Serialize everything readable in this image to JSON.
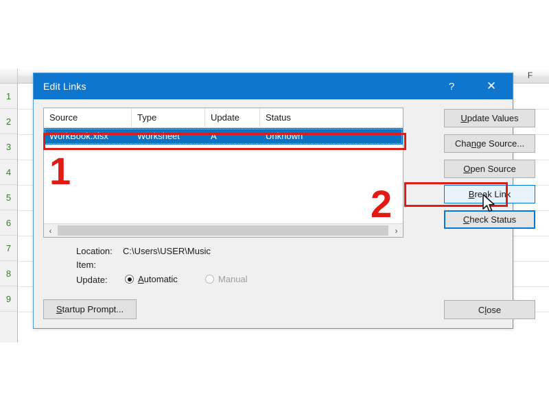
{
  "background": {
    "app": "Microsoft Excel",
    "column_headers": [
      "F"
    ],
    "row_headers": [
      "1",
      "2",
      "3",
      "4",
      "5",
      "6",
      "7",
      "8",
      "9"
    ]
  },
  "dialog": {
    "title": "Edit Links",
    "help_icon": "?",
    "close_icon": "✕",
    "list": {
      "columns": [
        "Source",
        "Type",
        "Update",
        "Status"
      ],
      "rows": [
        {
          "source": "WorkBook.xlsx",
          "type": "Worksheet",
          "update": "A",
          "status": "Unknown",
          "selected": true
        }
      ],
      "scrollbar": {
        "left_arrow": "‹",
        "right_arrow": "›"
      }
    },
    "buttons": {
      "update_values": {
        "pre": "U",
        "post": "pdate Values"
      },
      "change_source": {
        "pre": "Cha",
        "mid": "n",
        "post": "ge Source..."
      },
      "open_source": {
        "pre": "O",
        "post": "pen Source"
      },
      "break_link": {
        "pre": "B",
        "post": "reak Link"
      },
      "check_status": {
        "pre": "C",
        "post": "heck Status"
      },
      "startup_prompt": {
        "pre": "S",
        "post": "tartup Prompt..."
      },
      "close": {
        "pre": "C",
        "mid": "l",
        "post": "ose"
      }
    },
    "details": {
      "location_label": "Location:",
      "location_value": "C:\\Users\\USER\\Music",
      "item_label": "Item:",
      "item_value": "",
      "update_label": "Update:",
      "radio_automatic": {
        "pre": "A",
        "post": "utomatic",
        "checked": true
      },
      "radio_manual": {
        "label": "Manual",
        "checked": false,
        "disabled": true
      }
    }
  },
  "annotations": [
    {
      "number": "1",
      "target": "selected-link-row"
    },
    {
      "number": "2",
      "target": "break-link-button"
    }
  ],
  "colors": {
    "title_bar": "#0f76ce",
    "selection": "#0b72c4",
    "annotation_red": "#e01b14",
    "focus_blue": "#0078d7",
    "dialog_bg": "#f0f0f0"
  }
}
